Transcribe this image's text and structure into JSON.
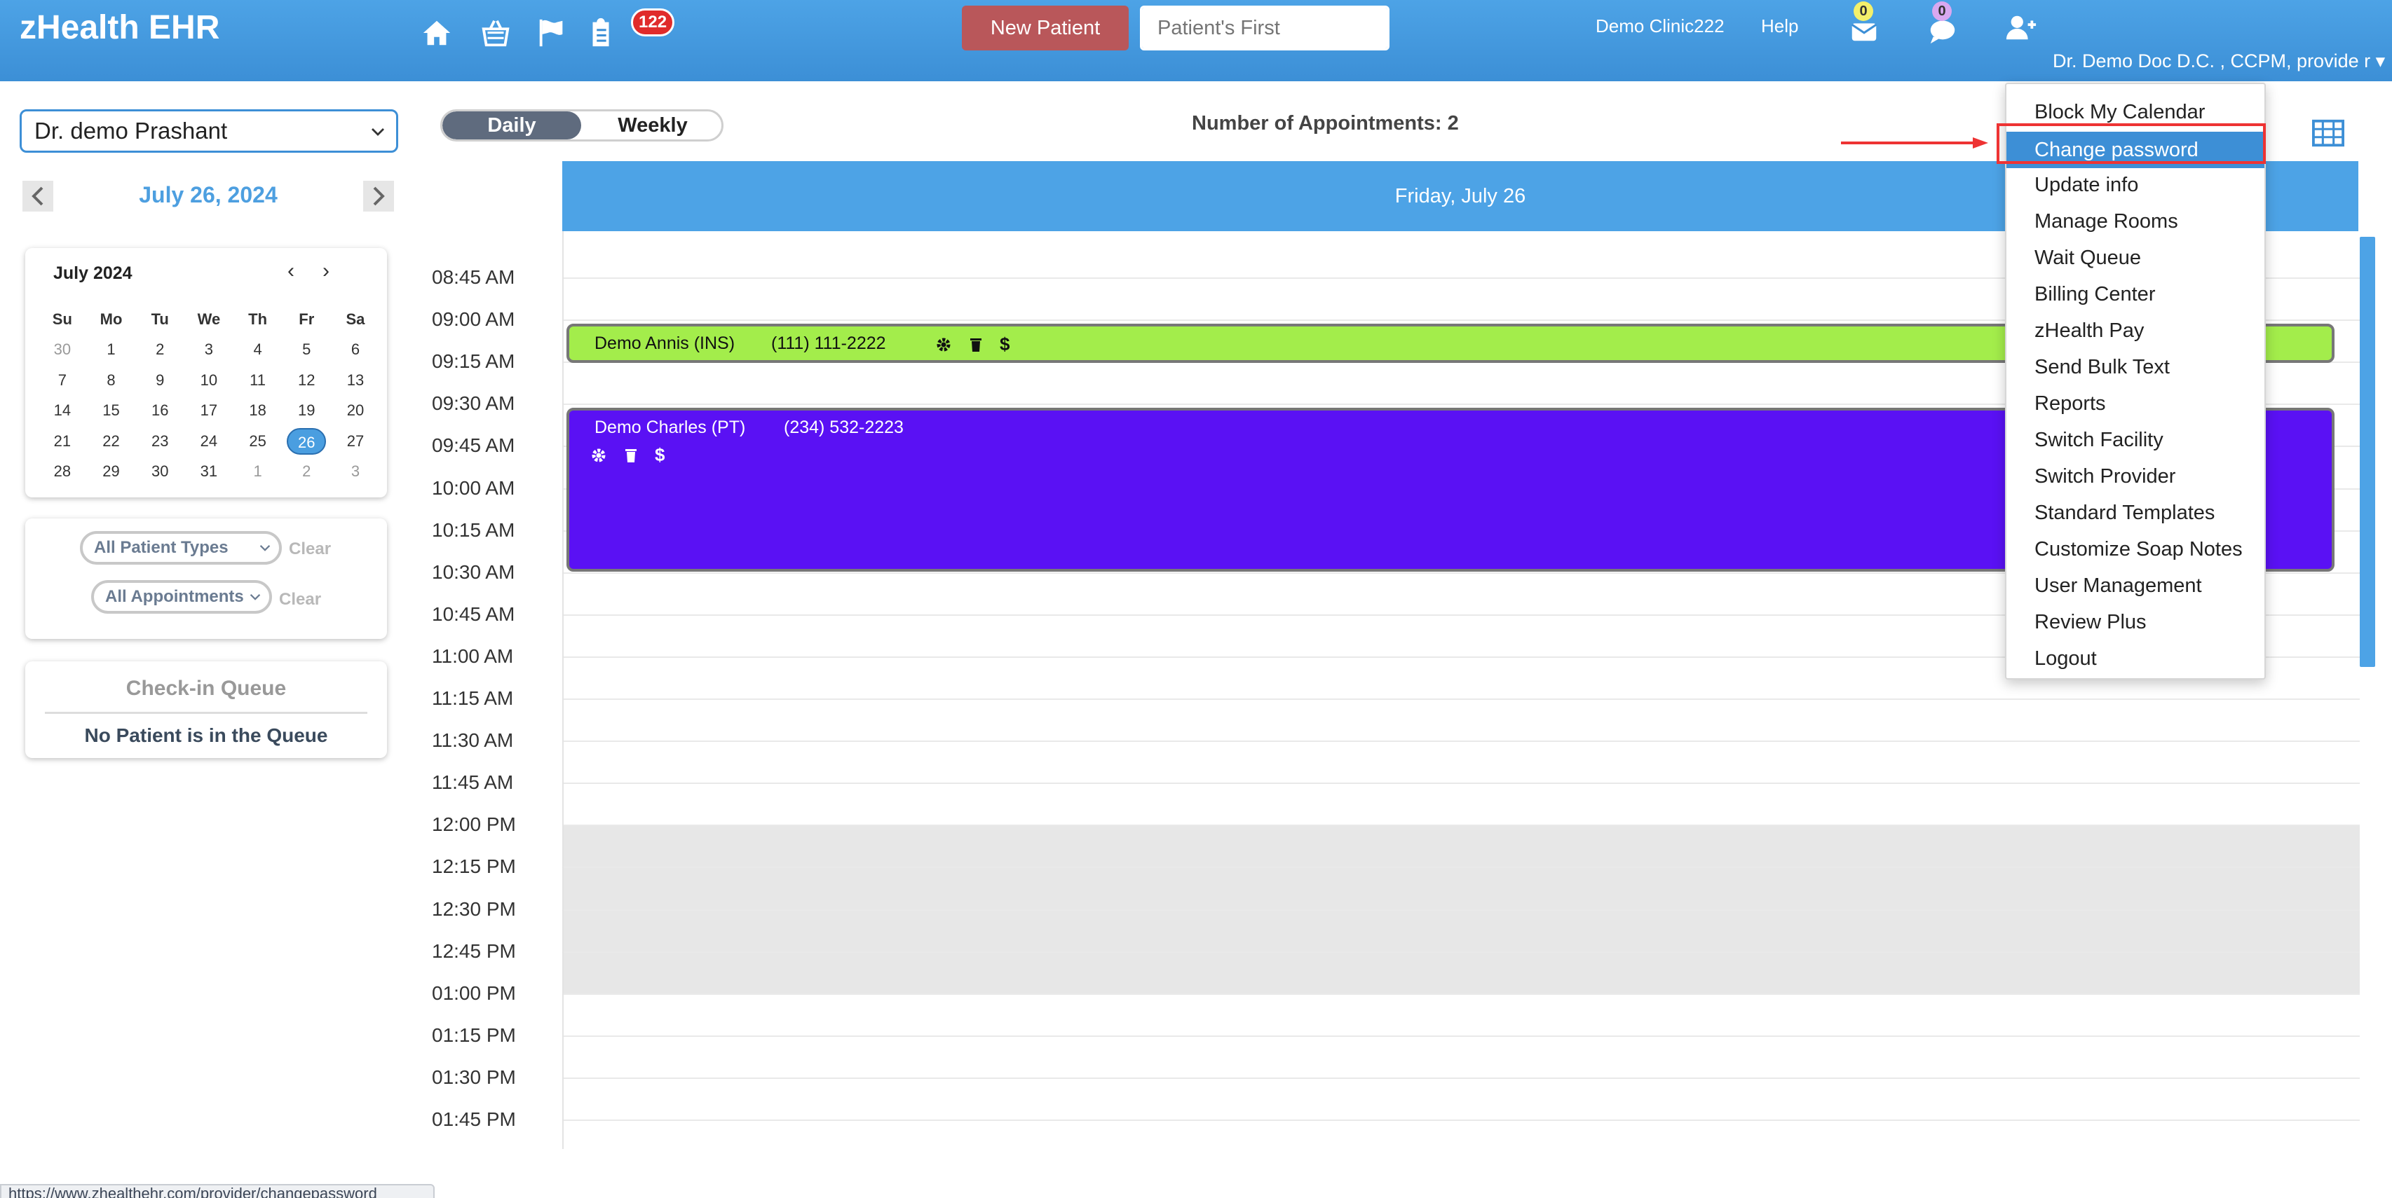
{
  "header": {
    "brand": "zHealth EHR",
    "notification_count": "122",
    "new_patient_label": "New Patient",
    "search_placeholder": "Patient's First",
    "clinic": "Demo Clinic222",
    "help": "Help",
    "mail_count": "0",
    "chat_count": "0",
    "provider_name": "Dr. Demo Doc D.C. , CCPM, provide r ▾",
    "icons": [
      "home-icon",
      "basket-icon",
      "flag-icon",
      "clipboard-icon",
      "mail-icon",
      "chat-icon",
      "add-user-icon",
      "search-icon"
    ]
  },
  "sidebar": {
    "provider": "Dr. demo Prashant",
    "date": "July 26, 2024",
    "mini_calendar": {
      "month": "July 2024",
      "weekdays": [
        "Su",
        "Mo",
        "Tu",
        "We",
        "Th",
        "Fr",
        "Sa"
      ],
      "weeks": [
        [
          "30",
          "1",
          "2",
          "3",
          "4",
          "5",
          "6"
        ],
        [
          "7",
          "8",
          "9",
          "10",
          "11",
          "12",
          "13"
        ],
        [
          "14",
          "15",
          "16",
          "17",
          "18",
          "19",
          "20"
        ],
        [
          "21",
          "22",
          "23",
          "24",
          "25",
          "26",
          "27"
        ],
        [
          "28",
          "29",
          "30",
          "31",
          "1",
          "2",
          "3"
        ]
      ],
      "selected": "26"
    },
    "filters": {
      "patient_types": "All Patient Types",
      "appointments": "All Appointments",
      "clear": "Clear"
    },
    "queue": {
      "title": "Check-in Queue",
      "empty": "No Patient is in the Queue"
    }
  },
  "main": {
    "view_toggle": {
      "daily": "Daily",
      "weekly": "Weekly"
    },
    "appt_count": "Number of Appointments: 2",
    "day_header": "Friday, July 26",
    "times": [
      "08:45 AM",
      "09:00 AM",
      "09:15 AM",
      "09:30 AM",
      "09:45 AM",
      "10:00 AM",
      "10:15 AM",
      "10:30 AM",
      "10:45 AM",
      "11:00 AM",
      "11:15 AM",
      "11:30 AM",
      "11:45 AM",
      "12:00 PM",
      "12:15 PM",
      "12:30 PM",
      "12:45 PM",
      "01:00 PM",
      "01:15 PM",
      "01:30 PM",
      "01:45 PM"
    ],
    "appointments": [
      {
        "name": "Demo Annis (INS)",
        "phone": "(111) 111-2222",
        "color": "#a3ed4b"
      },
      {
        "name": "Demo Charles (PT)",
        "phone": "(234) 532-2223",
        "color": "#5a11f4"
      }
    ],
    "dollar": "$"
  },
  "menu": {
    "items": [
      "Block My Calendar",
      "Change password",
      "Update info",
      "Manage Rooms",
      "Wait Queue",
      "Billing Center",
      "zHealth Pay",
      "Send Bulk Text",
      "Reports",
      "Switch Facility",
      "Switch Provider",
      "Standard Templates",
      "Customize Soap Notes",
      "User Management",
      "Review Plus",
      "Logout"
    ],
    "active": "Change password"
  },
  "statusbar": "https://www.zhealthehr.com/provider/changepassword",
  "colors": {
    "header": "#4da3e6",
    "accent": "#3d8fd6",
    "new_patient": "#b9575a",
    "highlight": "#ee3333"
  }
}
